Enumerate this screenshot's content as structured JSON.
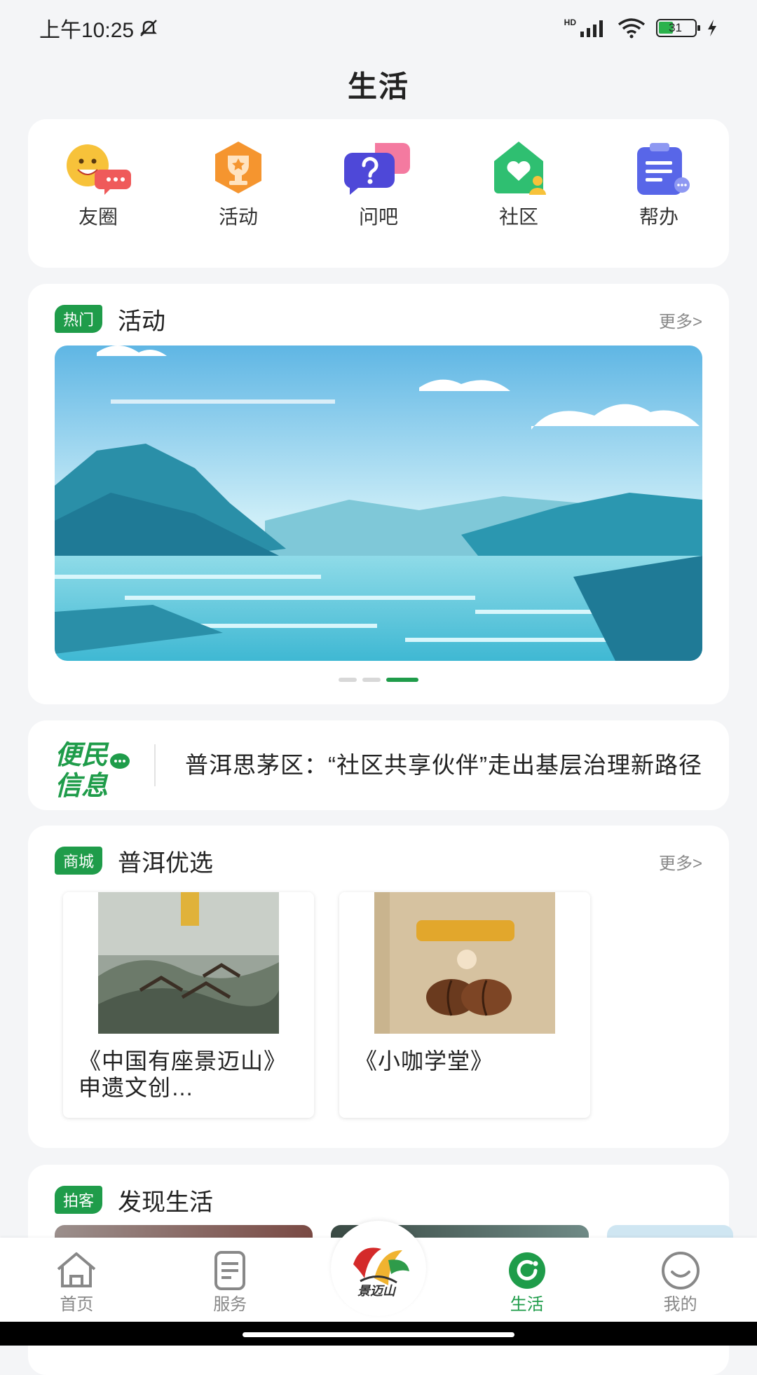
{
  "status_bar": {
    "time": "上午10:25",
    "signal": "HD",
    "battery": "31"
  },
  "header": {
    "title": "生活"
  },
  "quick_links": [
    {
      "label": "友圈",
      "icon": "chat-emoji-icon"
    },
    {
      "label": "活动",
      "icon": "trophy-icon"
    },
    {
      "label": "问吧",
      "icon": "question-icon"
    },
    {
      "label": "社区",
      "icon": "community-heart-icon"
    },
    {
      "label": "帮办",
      "icon": "clipboard-icon"
    }
  ],
  "hot": {
    "tag": "热门",
    "title": "活动",
    "more": "更多>",
    "carousel": {
      "active_index": 2,
      "count": 3
    }
  },
  "news": {
    "logo_text_1": "便民",
    "logo_text_2": "信息",
    "headline": "普洱思茅区：“社区共享伙伴”走出基层治理新路径"
  },
  "shop": {
    "tag": "商城",
    "title": "普洱优选",
    "more": "更多>",
    "items": [
      {
        "name": "《中国有座景迈山》申遗文创…"
      },
      {
        "name": "《小咖学堂》"
      }
    ]
  },
  "life": {
    "tag": "拍客",
    "title": "发现生活"
  },
  "tabbar": {
    "tabs": [
      {
        "label": "首页",
        "icon": "home-icon"
      },
      {
        "label": "服务",
        "icon": "document-icon"
      },
      {
        "label": "生活",
        "icon": "life-icon",
        "active": true
      },
      {
        "label": "我的",
        "icon": "smile-icon"
      }
    ],
    "center_logo_text": "景迈山"
  },
  "colors": {
    "accent": "#1f9c4a",
    "background": "#f4f5f7"
  }
}
